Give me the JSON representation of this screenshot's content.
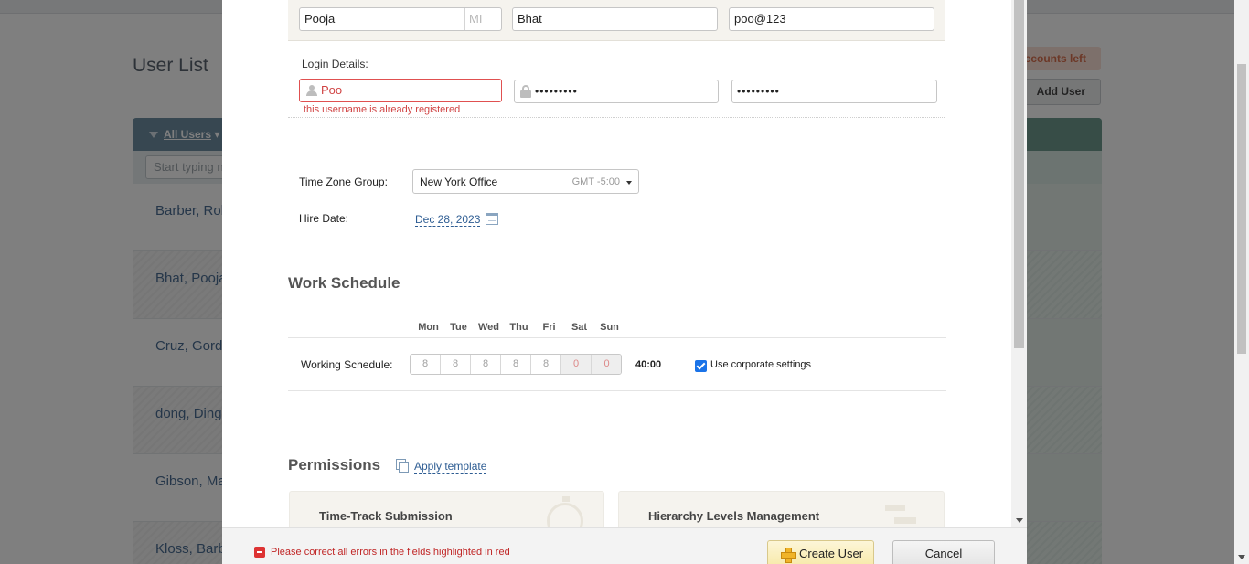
{
  "background": {
    "title": "User List",
    "accounts_badge": "ccounts left",
    "add_user_label": "Add User",
    "filter_label": "All Users",
    "search_placeholder": "Start typing n",
    "users": [
      "Barber, Rob",
      "Bhat, Pooja",
      "Cruz, Gordo",
      "dong, Dinga",
      "Gibson, Ma",
      "Kloss, Barb"
    ]
  },
  "form": {
    "first_name": "Pooja",
    "middle_initial_placeholder": "MI",
    "last_name": "Bhat",
    "email": "poo@123",
    "login_label": "Login Details:",
    "username": "Poo",
    "password_mask": "•••••••••",
    "confirm_password_mask": "•••••••••",
    "username_error": "this username is already registered",
    "timezone_label": "Time Zone Group:",
    "timezone_value": "New York Office",
    "timezone_offset": "GMT -5:00",
    "hire_date_label": "Hire Date:",
    "hire_date_value": "Dec 28, 2023"
  },
  "schedule": {
    "title": "Work Schedule",
    "days": [
      "Mon",
      "Tue",
      "Wed",
      "Thu",
      "Fri",
      "Sat",
      "Sun"
    ],
    "row_label": "Working Schedule:",
    "hours": [
      "8",
      "8",
      "8",
      "8",
      "8",
      "0",
      "0"
    ],
    "total": "40:00",
    "use_corporate_label": "Use corporate settings",
    "use_corporate_checked": true
  },
  "permissions": {
    "title": "Permissions",
    "apply_template": "Apply template",
    "cards": [
      "Time-Track Submission",
      "Hierarchy Levels Management"
    ]
  },
  "footer": {
    "error_message": "Please correct all errors in the fields highlighted in red",
    "create_label": "Create User",
    "cancel_label": "Cancel"
  },
  "colors": {
    "error": "#d04444",
    "link": "#2e5d93",
    "create_button": "#f7e9a8",
    "checkbox": "#1a73e8"
  }
}
